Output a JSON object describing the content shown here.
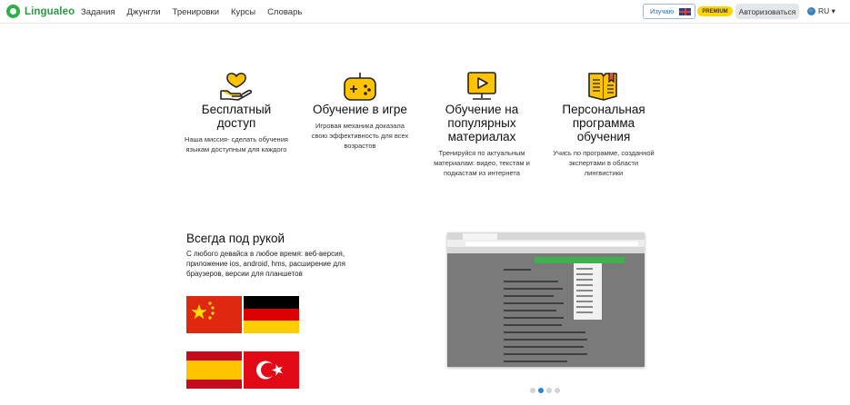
{
  "header": {
    "logo_text": "Lingualeo",
    "nav": [
      "Задания",
      "Джунгли",
      "Тренировки",
      "Курсы",
      "Словарь"
    ],
    "study_label": "Изучаю",
    "study_flag_icon": "uk-flag-icon",
    "premium_label": "PREMIUM",
    "login_label": "Авторизоваться",
    "language": "RU ▾"
  },
  "features": [
    {
      "icon": "heart-hand-icon",
      "title": "Бесплатный доступ",
      "text": "Наша миссия- сделать обучения языкам доступным для каждого"
    },
    {
      "icon": "gamepad-icon",
      "title": "Обучение в игре",
      "text": "Игровая механика доказала свою эффективность для всех возрастов"
    },
    {
      "icon": "video-play-icon",
      "title": "Обучение на популярных материалах",
      "text": "Тренируйся по актуальным материалам: видео, текстам и подкастам из интернета"
    },
    {
      "icon": "book-icon",
      "title": "Персональная программа обучения",
      "text": "Учись по программе, созданной экспертами в области лингвистики"
    }
  ],
  "always": {
    "title": "Всегда под рукой",
    "text": "С любого девайса в любое время: веб-версия, приложение ios, android, hms, расширение для браузеров, версии для планшетов"
  },
  "flags": [
    "china-flag",
    "germany-flag",
    "spain-flag",
    "turkey-flag"
  ],
  "colors": {
    "accent_yellow": "#ffc300",
    "brand_green": "#2db04a",
    "link_blue": "#2e6ab4",
    "dot_active": "#2e7fd8"
  },
  "carousel": {
    "total": 4,
    "active": 2
  }
}
